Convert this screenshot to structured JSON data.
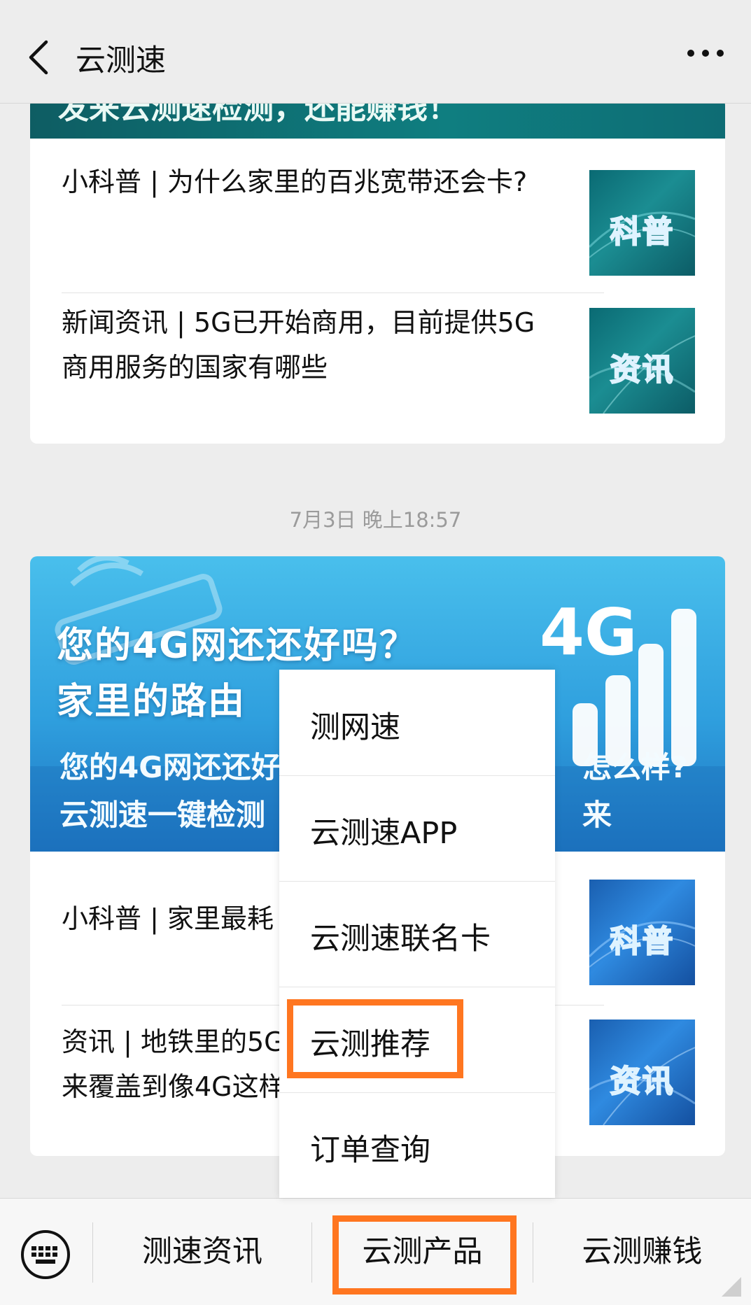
{
  "nav": {
    "title": "云测速",
    "back_icon": "chevron-left-icon",
    "more_icon": "more-dots-icon"
  },
  "card1": {
    "banner_text": "发来云测速检测，还能赚钱！",
    "articles": [
      {
        "title": "小科普 | 为什么家里的百兆宽带还会卡?",
        "thumb_label": "科普"
      },
      {
        "title": "新闻资讯 | 5G已开始商用，目前提供5G商用服务的国家有哪些",
        "thumb_label": "资讯"
      }
    ]
  },
  "timestamp": "7月3日 晚上18:57",
  "card2": {
    "hero": {
      "headline_1": "您的4G网还还好吗？",
      "headline_2": "家里的路由",
      "badge": "4G",
      "subtitle_1": "您的4G网还还好",
      "subtitle_1_tail": "怎么样?来",
      "subtitle_2": "云测速一键检测"
    },
    "articles": [
      {
        "title": "小科普 | 家里最耗",
        "thumb_label": "科普"
      },
      {
        "title_1": "资讯 | 地铁里的5G",
        "title_2": "来覆盖到像4G这样",
        "thumb_label": "资讯"
      }
    ]
  },
  "menu": {
    "items": [
      "测网速",
      "云测速APP",
      "云测速联名卡",
      "云测推荐",
      "订单查询"
    ],
    "highlighted": "云测推荐"
  },
  "tabbar": {
    "keyboard_icon": "keyboard-icon",
    "tabs": [
      "测速资讯",
      "云测产品",
      "云测赚钱"
    ],
    "highlighted": "云测产品"
  },
  "colors": {
    "highlight": "#ff7620",
    "background": "#ededed"
  }
}
